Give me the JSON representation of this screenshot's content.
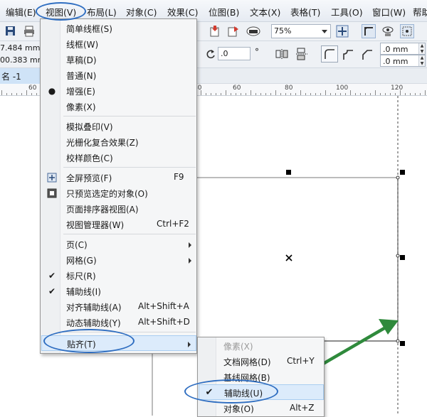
{
  "menubar": {
    "items": [
      {
        "label": "编辑(E)"
      },
      {
        "label": "视图(V)"
      },
      {
        "label": "布局(L)"
      },
      {
        "label": "对象(C)"
      },
      {
        "label": "效果(C)"
      },
      {
        "label": "位图(B)"
      },
      {
        "label": "文本(X)"
      },
      {
        "label": "表格(T)"
      },
      {
        "label": "工具(O)"
      },
      {
        "label": "窗口(W)"
      },
      {
        "label": "帮助"
      }
    ]
  },
  "toolbar": {
    "zoom": "75%"
  },
  "property_bar": {
    "width_value": "7.484 mm",
    "height_value": "00.383 mm",
    "rotation_value": ".0",
    "degree_symbol": "°",
    "nudge_x": ".0 mm",
    "nudge_y": ".0 mm"
  },
  "document_tab": {
    "label": "名 -1"
  },
  "ruler": {
    "labels": [
      "60",
      "40",
      "60",
      "80",
      "100",
      "120"
    ]
  },
  "view_menu": {
    "items": [
      {
        "label": "简单线框(S)",
        "shortcut": "",
        "mark": ""
      },
      {
        "label": "线框(W)",
        "shortcut": "",
        "mark": ""
      },
      {
        "label": "草稿(D)",
        "shortcut": "",
        "mark": ""
      },
      {
        "label": "普通(N)",
        "shortcut": "",
        "mark": ""
      },
      {
        "label": "增强(E)",
        "shortcut": "",
        "mark": "●"
      },
      {
        "label": "像素(X)",
        "shortcut": "",
        "mark": ""
      },
      {
        "label": "模拟叠印(V)",
        "shortcut": "",
        "mark": ""
      },
      {
        "label": "光栅化复合效果(Z)",
        "shortcut": "",
        "mark": ""
      },
      {
        "label": "校样颜色(C)",
        "shortcut": "",
        "mark": ""
      },
      {
        "label": "全屏预览(F)",
        "shortcut": "F9",
        "mark": ""
      },
      {
        "label": "只预览选定的对象(O)",
        "shortcut": "",
        "mark": ""
      },
      {
        "label": "页面排序器视图(A)",
        "shortcut": "",
        "mark": ""
      },
      {
        "label": "视图管理器(W)",
        "shortcut": "Ctrl+F2",
        "mark": ""
      },
      {
        "label": "页(C)",
        "shortcut": "",
        "mark": ""
      },
      {
        "label": "网格(G)",
        "shortcut": "",
        "mark": ""
      },
      {
        "label": "标尺(R)",
        "shortcut": "",
        "mark": "✔"
      },
      {
        "label": "辅助线(I)",
        "shortcut": "",
        "mark": "✔"
      },
      {
        "label": "对齐辅助线(A)",
        "shortcut": "Alt+Shift+A",
        "mark": ""
      },
      {
        "label": "动态辅助线(Y)",
        "shortcut": "Alt+Shift+D",
        "mark": ""
      },
      {
        "label": "贴齐(T)",
        "shortcut": "",
        "mark": ""
      }
    ]
  },
  "snap_menu": {
    "items": [
      {
        "label": "像素(X)",
        "shortcut": "",
        "mark": ""
      },
      {
        "label": "文档网格(D)",
        "shortcut": "Ctrl+Y",
        "mark": ""
      },
      {
        "label": "基线网格(B)",
        "shortcut": "",
        "mark": ""
      },
      {
        "label": "辅助线(U)",
        "shortcut": "",
        "mark": "✔"
      },
      {
        "label": "对象(O)",
        "shortcut": "Alt+Z",
        "mark": ""
      }
    ]
  },
  "colors": {
    "annotation_blue": "#2f6ec1",
    "arrow_green": "#2f8a3c",
    "menu_highlight": "#dcebfb"
  }
}
